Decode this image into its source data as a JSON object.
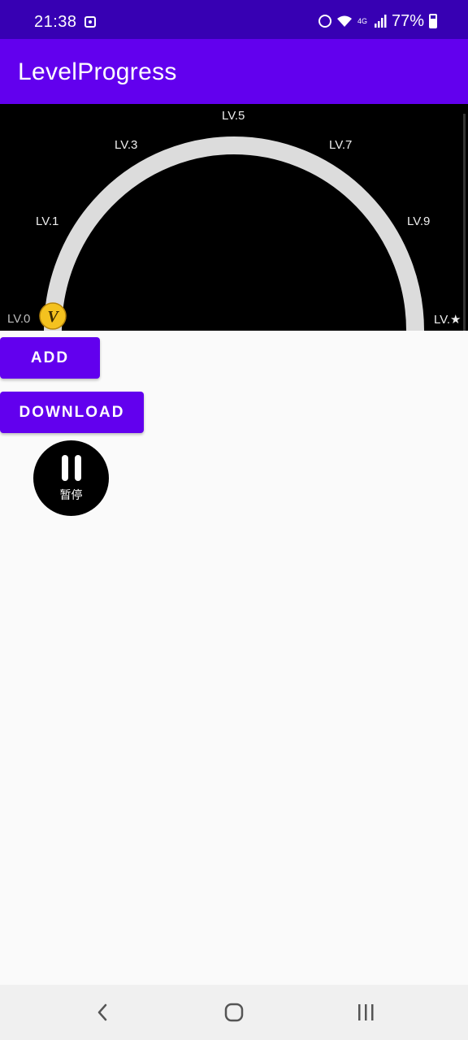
{
  "status_bar": {
    "time": "21:38",
    "network": "4G",
    "battery": "77%",
    "icons": [
      "app-notification-icon",
      "alarm-icon",
      "wifi-icon",
      "signal-icon",
      "battery-icon"
    ]
  },
  "app_bar": {
    "title": "LevelProgress"
  },
  "level_gauge": {
    "labels": {
      "lv0": "LV.0",
      "lv1": "LV.1",
      "lv3": "LV.3",
      "lv5": "LV.5",
      "lv7": "LV.7",
      "lv9": "LV.9",
      "max": "LV.★"
    },
    "badge_letter": "V",
    "progress_fraction": 0.0,
    "colors": {
      "track": "#dcdcdc",
      "badge": "#f4c21f",
      "background": "#000000"
    }
  },
  "buttons": {
    "add": "ADD",
    "download": "DOWNLOAD"
  },
  "pause_control": {
    "label": "暂停",
    "icon": "pause-icon"
  },
  "navigation": {
    "back": "back-icon",
    "home": "home-icon",
    "recents": "recents-icon"
  },
  "colors": {
    "primary": "#6200ee",
    "primary_dark": "#3700b3"
  }
}
